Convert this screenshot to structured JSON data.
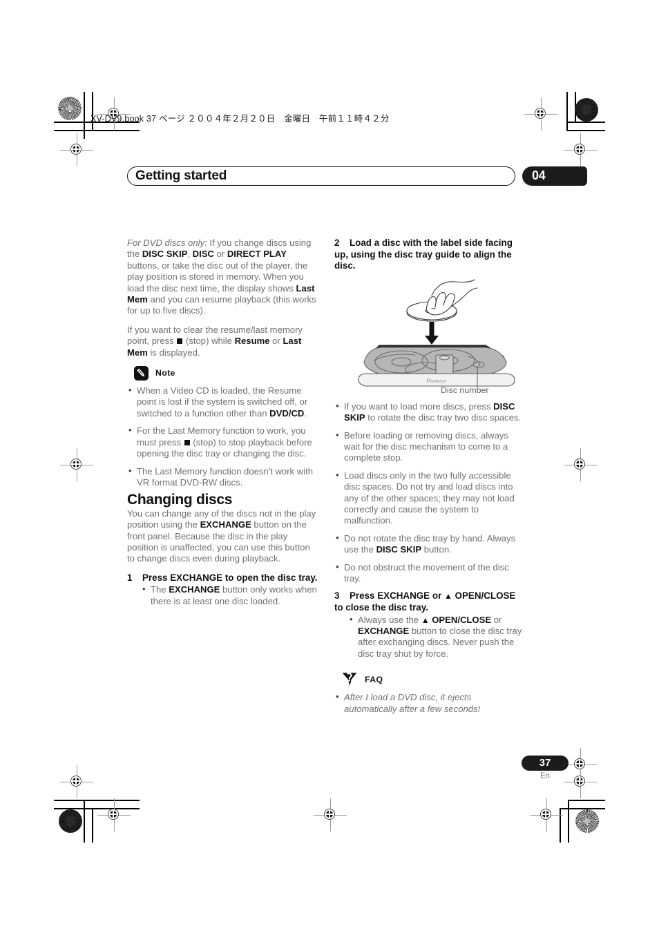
{
  "print_marks": {
    "file_line": "XV-DV9.book  37 ページ  ２００４年２月２０日　金曜日　午前１１時４２分"
  },
  "header": {
    "title": "Getting started",
    "chapter": "04"
  },
  "left_column": {
    "intro_para_1": {
      "lead_italic": "For DVD discs only:",
      "text_1": " If you change discs using the ",
      "bold_1": "DISC SKIP",
      "text_2": ", ",
      "bold_2": "DISC",
      "text_3": " or ",
      "bold_3": "DIRECT PLAY",
      "text_4": " buttons, or take the disc out of the player, the play position is stored in memory. When you load the disc next time, the display shows ",
      "bold_4": "Last Mem",
      "text_5": " and you can resume playback (this works for up to five discs)."
    },
    "intro_para_2": {
      "text_1": "If you want to clear the resume/last memory point, press ",
      "stop_icon": "stop-square-icon",
      "text_2": " (stop) while ",
      "bold_1": "Resume",
      "text_3": " or ",
      "bold_2": "Last Mem",
      "text_4": " is displayed."
    },
    "note": {
      "icon": "pencil-note-icon",
      "label": "Note",
      "items": [
        {
          "text_1": "When a Video CD is loaded, the Resume point is lost if the system is switched off, or switched to a function other than ",
          "bold_1": "DVD/CD",
          "text_2": "."
        },
        {
          "text_1": "For the Last Memory function to work, you must press ",
          "stop_icon": "stop-square-icon",
          "text_2": " (stop) to stop playback before opening the disc tray or changing the disc."
        },
        {
          "text_1": "The Last Memory function doesn't work with VR format DVD-RW discs."
        }
      ]
    },
    "section_heading": "Changing discs",
    "section_para": {
      "text_1": "You can change any of the discs not in the play position using the ",
      "bold_1": "EXCHANGE",
      "text_2": " button on the front panel. Because the disc in the play position is unaffected, you can use this button to change discs even during playback."
    },
    "step_1": {
      "number": "1",
      "text": "Press EXCHANGE to open the disc tray."
    },
    "step_1_bullets": [
      {
        "text_1": "The ",
        "bold_1": "EXCHANGE",
        "text_2": " button only works when there is at least one disc loaded."
      }
    ]
  },
  "right_column": {
    "step_2": {
      "number": "2",
      "text": "Load a disc with the label side facing up, using the disc tray guide to align the disc."
    },
    "illustration": {
      "name": "disc-tray-loading-illustration",
      "brand_mark": "Pioneer",
      "caption": "Disc number"
    },
    "step_2_bullets": [
      {
        "text_1": "If you want to load more discs, press ",
        "bold_1": "DISC SKIP",
        "text_2": " to rotate the disc tray two disc spaces."
      },
      {
        "text_1": "Before loading or removing discs, always wait for the disc mechanism to come to a complete stop."
      },
      {
        "text_1": "Load discs only in the two fully accessible disc spaces. Do not try and load discs into any of the other spaces; they may not load correctly and cause the system to malfunction."
      },
      {
        "text_1": "Do not rotate the disc tray by hand. Always use the ",
        "bold_1": "DISC SKIP",
        "text_2": " button."
      },
      {
        "text_1": "Do not obstruct the movement of the disc tray."
      }
    ],
    "step_3": {
      "number": "3",
      "text_1": "Press EXCHANGE or ",
      "eject_icon": "eject-triangle-icon",
      "text_2": " OPEN/CLOSE to close the disc tray."
    },
    "step_3_bullets": [
      {
        "text_1": "Always use the ",
        "eject_icon": "eject-triangle-icon",
        "bold_1": " OPEN/CLOSE",
        "text_2": " or ",
        "bold_2": "EXCHANGE",
        "text_3": " button to close the disc tray after exchanging discs. Never push the disc tray shut by force."
      }
    ],
    "faq": {
      "icon": "faq-speech-bubble-icon",
      "label": "FAQ",
      "items": [
        {
          "text_1": "After I load a DVD disc, it ejects automatically after a few seconds!"
        }
      ]
    }
  },
  "footer": {
    "page_number": "37",
    "language": "En"
  },
  "colors": {
    "body_text": "#6f6f6f",
    "bold_text": "#141414",
    "accent_dark": "#1b1b1b",
    "tray_grey": "#b4b4b4"
  }
}
